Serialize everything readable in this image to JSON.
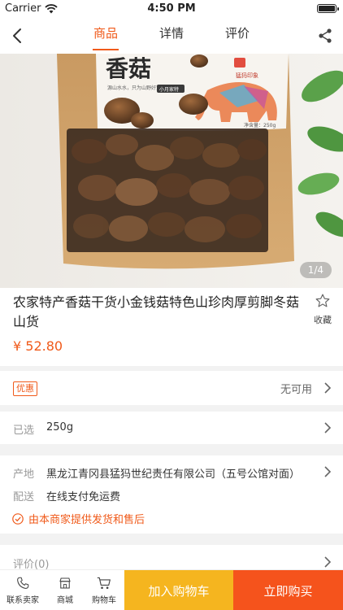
{
  "status_bar": {
    "carrier": "Carrier",
    "time": "4:50 PM"
  },
  "nav": {
    "tabs": [
      {
        "label": "商品",
        "active": true
      },
      {
        "label": "详情",
        "active": false
      },
      {
        "label": "评价",
        "active": false
      }
    ],
    "accent_color": "#f05a1a"
  },
  "product_image": {
    "pager": "1/4",
    "package_text": {
      "name": "香菇",
      "slogan": "源山水水，只为山野好货",
      "badge": "小月家特",
      "brand": "猛犸印象",
      "weight": "净含量：250g"
    }
  },
  "product": {
    "title": "农家特产香菇干货小金钱菇特色山珍肉厚剪脚冬菇山货",
    "price": "¥ 52.80",
    "favorite_label": "收藏"
  },
  "coupon": {
    "tag": "优惠",
    "status": "无可用"
  },
  "selected": {
    "label": "已选",
    "value": "250g"
  },
  "origin": {
    "label": "产地",
    "value": "黑龙江青冈县猛犸世纪责任有限公司（五号公馆对面）"
  },
  "delivery": {
    "label": "配送",
    "value": "在线支付免运费"
  },
  "guarantee": {
    "text": "由本商家提供发货和售后"
  },
  "reviews": {
    "label": "评价(0)"
  },
  "bottom_bar": {
    "contact_label": "联系卖家",
    "store_label": "商城",
    "cart_label": "购物车",
    "add_to_cart": "加入购物车",
    "buy_now": "立即购买",
    "cart_button_color": "#f5b51f",
    "buy_button_color": "#f5531c"
  }
}
